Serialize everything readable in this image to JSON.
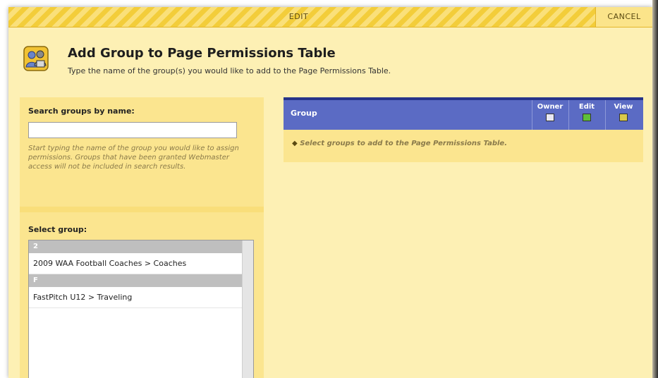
{
  "dialog": {
    "top_bar": {
      "edit_label": "EDIT",
      "cancel_label": "CANCEL"
    },
    "header": {
      "title": "Add Group to Page Permissions Table",
      "subtitle": "Type the name of the group(s) you would like to add to the Page Permissions Table."
    },
    "search": {
      "label": "Search groups by name:",
      "value": "",
      "placeholder": "",
      "help": "Start typing the name of the group you would like to assign permissions. Groups that have been granted Webmaster access will not be included in search results."
    },
    "select": {
      "label": "Select group:",
      "sections": [
        {
          "letter": "2",
          "items": [
            "2009 WAA Football Coaches > Coaches"
          ]
        },
        {
          "letter": "F",
          "items": [
            "FastPitch U12 > Traveling"
          ]
        }
      ]
    },
    "table": {
      "group_header": "Group",
      "columns": [
        {
          "label": "Owner",
          "icon": "owner-icon",
          "color": "#e8e8f4"
        },
        {
          "label": "Edit",
          "icon": "edit-icon",
          "color": "#5fbf3a"
        },
        {
          "label": "View",
          "icon": "view-icon",
          "color": "#d9c94a"
        }
      ],
      "empty_message": "Select groups to add to the Page Permissions Table."
    }
  },
  "colors": {
    "dialog_bg": "#fdf0b4",
    "panel_bg": "#fbe58f",
    "table_header": "#5b6bc4",
    "help_text": "#8a7a4a"
  }
}
